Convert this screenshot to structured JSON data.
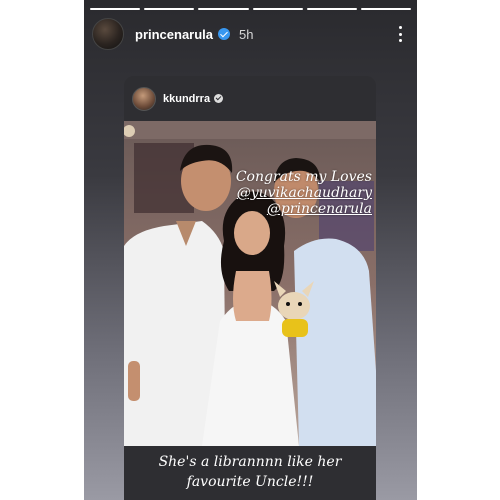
{
  "story": {
    "progress": {
      "total_segments": 6,
      "completed_segments": 6
    },
    "author": {
      "username": "princenarula",
      "verified": true,
      "posted_time": "5h"
    }
  },
  "shared_post": {
    "author": {
      "username": "kkundrra",
      "verified": true
    },
    "caption_lines": [
      "Congrats my Loves",
      "@yuvikachaudhary",
      "@princenarula"
    ]
  },
  "story_text": {
    "lines": [
      "She's a librannnn like her",
      "favourite Uncle!!!"
    ]
  },
  "colors": {
    "verified_badge": "#3897f0",
    "story_background_top": "#2a2a2e",
    "story_background_bottom": "#9a9aa4",
    "outfits": "#f2f2f2",
    "shirt_right": "#cfdcec",
    "dog_vest": "#e8c21a"
  },
  "icons": [
    "verified-badge-icon",
    "more-options-icon"
  ]
}
